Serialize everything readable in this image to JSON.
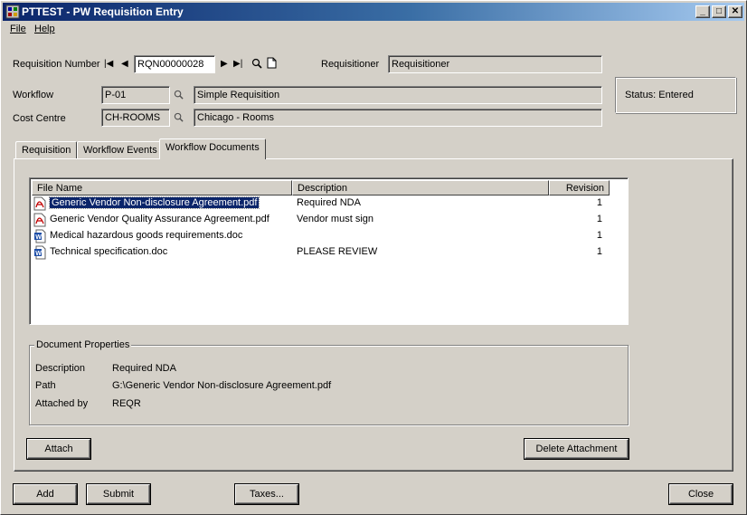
{
  "window": {
    "title": "PTTEST - PW Requisition Entry"
  },
  "menu": {
    "file": "File",
    "help": "Help"
  },
  "header": {
    "req_number_label": "Requisition Number",
    "req_number_value": "RQN00000028",
    "requisitioner_label": "Requisitioner",
    "requisitioner_value": "Requisitioner",
    "workflow_label": "Workflow",
    "workflow_code": "P-01",
    "workflow_desc": "Simple Requisition",
    "cost_centre_label": "Cost Centre",
    "cost_centre_code": "CH-ROOMS",
    "cost_centre_desc": "Chicago - Rooms",
    "status_text": "Status:  Entered"
  },
  "tabs": [
    {
      "label": "Requisition"
    },
    {
      "label": "Workflow Events"
    },
    {
      "label": "Workflow Documents"
    }
  ],
  "documents": {
    "columns": [
      "File Name",
      "Description",
      "Revision"
    ],
    "rows": [
      {
        "file": "Generic Vendor Non-disclosure Agreement.pdf",
        "desc": "Required NDA",
        "rev": "1",
        "icon": "pdf-icon"
      },
      {
        "file": "Generic Vendor Quality Assurance Agreement.pdf",
        "desc": "Vendor must sign",
        "rev": "1",
        "icon": "pdf-icon"
      },
      {
        "file": "Medical hazardous goods requirements.doc",
        "desc": "",
        "rev": "1",
        "icon": "word-doc-icon"
      },
      {
        "file": "Technical specification.doc",
        "desc": "PLEASE REVIEW",
        "rev": "1",
        "icon": "word-doc-icon"
      }
    ]
  },
  "properties": {
    "title": "Document Properties",
    "description_label": "Description",
    "description_value": "Required NDA",
    "path_label": "Path",
    "path_value": "G:\\Generic Vendor Non-disclosure Agreement.pdf",
    "attached_by_label": "Attached by",
    "attached_by_value": "REQR"
  },
  "buttons": {
    "attach": "Attach",
    "delete_attachment": "Delete Attachment",
    "add": "Add",
    "submit": "Submit",
    "taxes": "Taxes...",
    "close": "Close"
  },
  "colors": {
    "title_active": "#0a246a",
    "selection": "#0a246a",
    "face": "#d4d0c8"
  }
}
